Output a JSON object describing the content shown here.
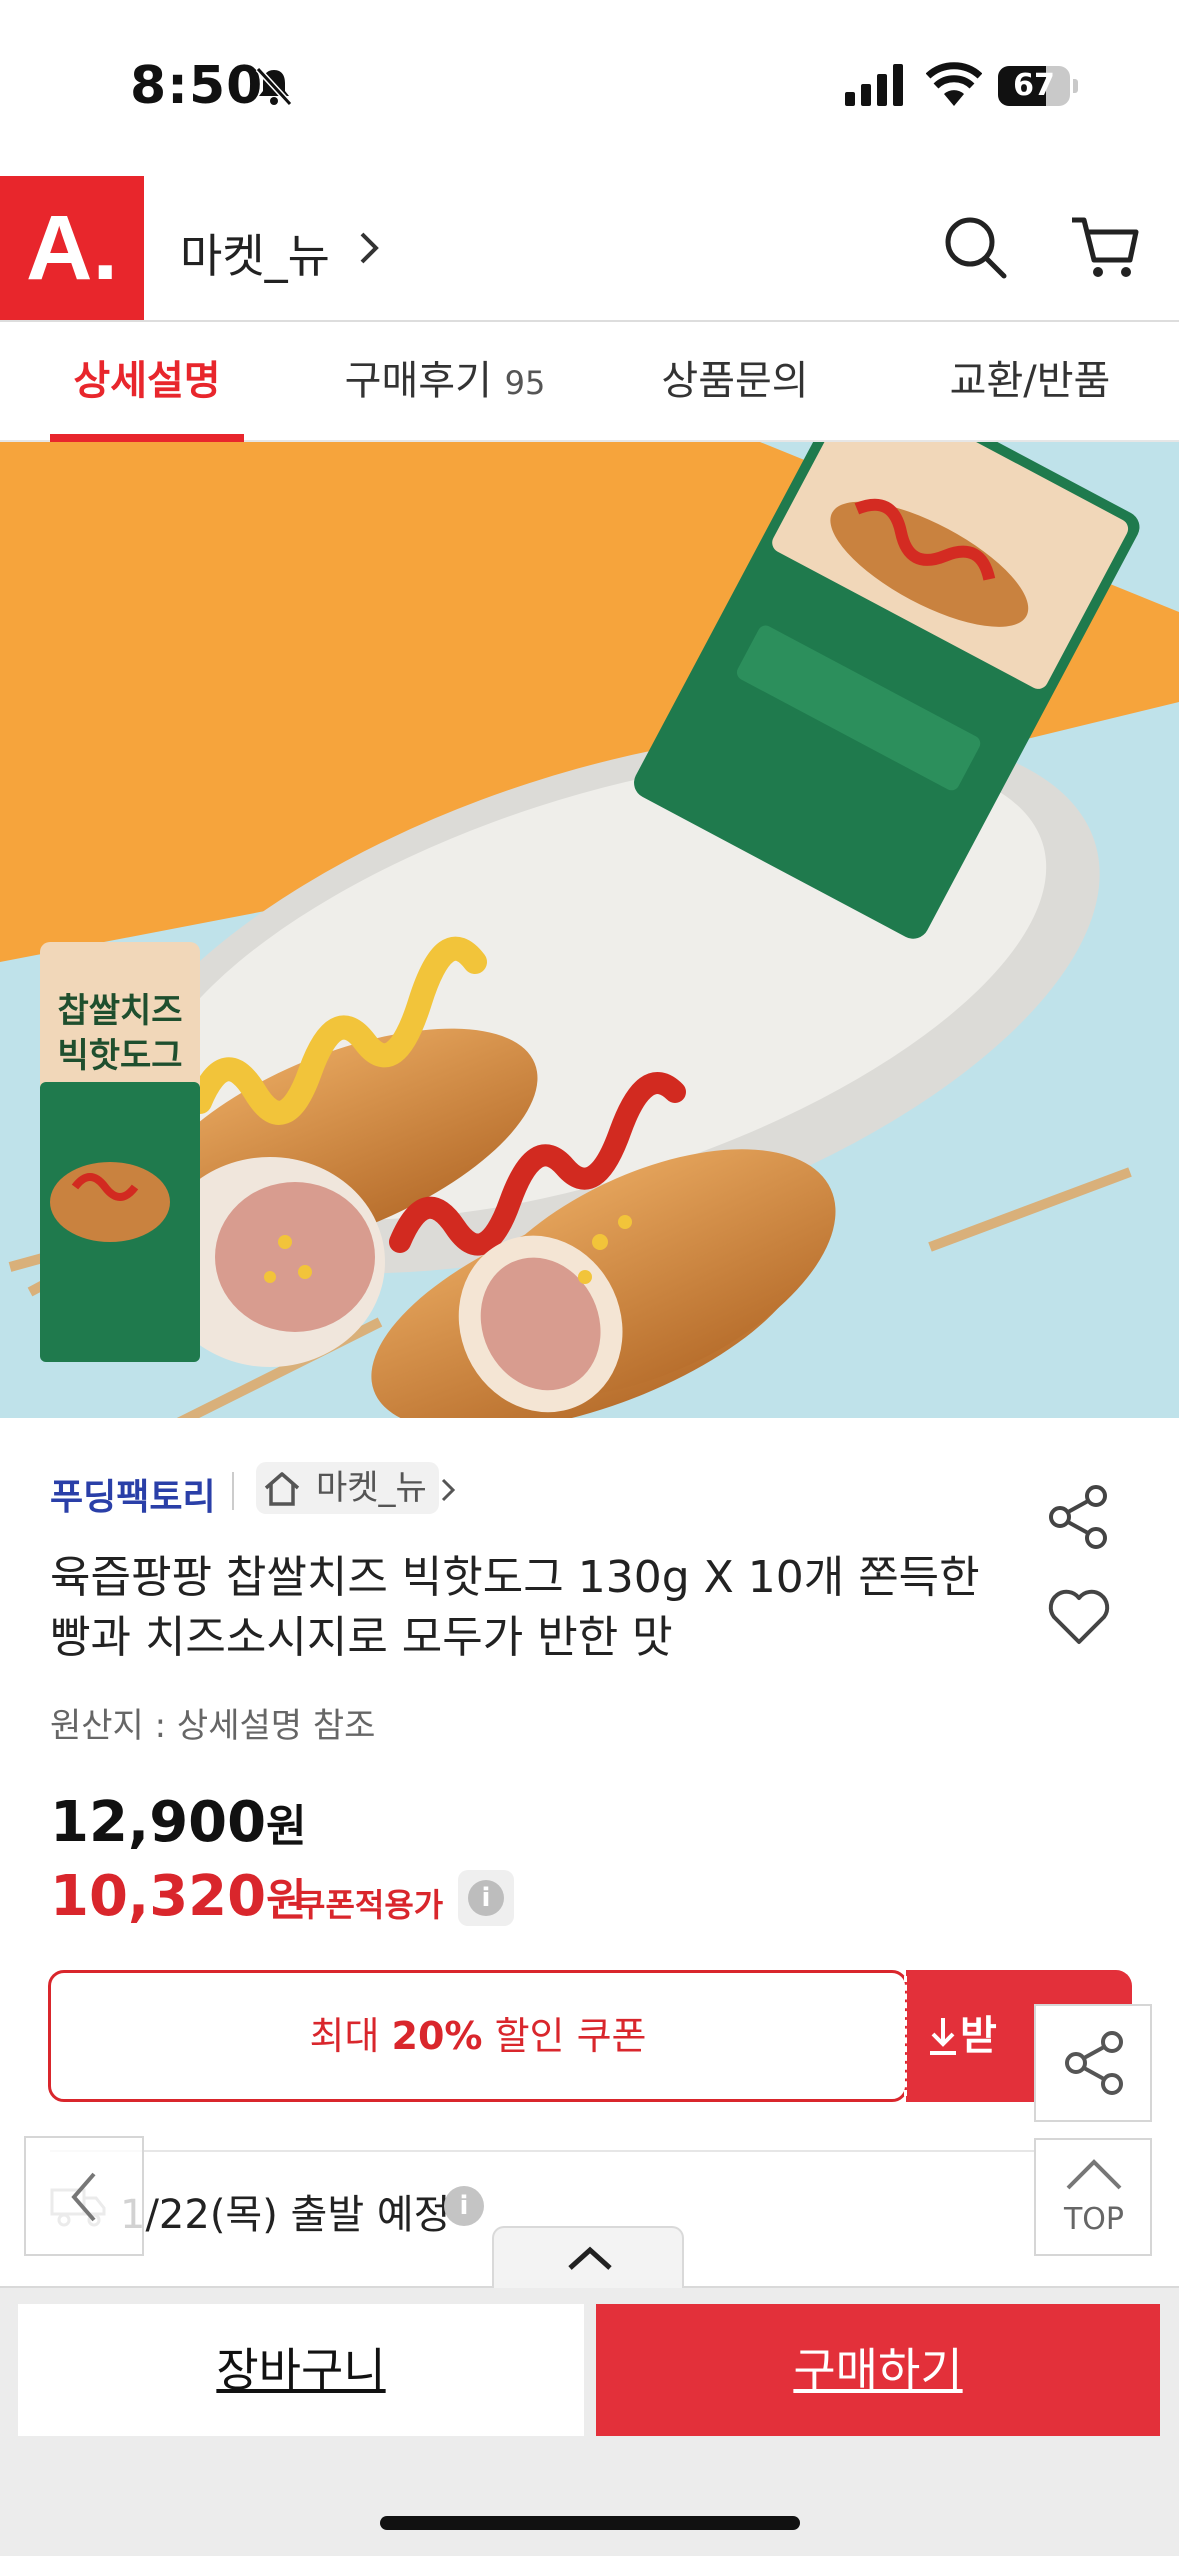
{
  "status_bar": {
    "time": "8:50",
    "battery": "67",
    "battery_level": 0.67
  },
  "header": {
    "logo": "A.",
    "store_name": "마켓_뉴"
  },
  "tabs": [
    {
      "label": "상세설명",
      "active": true
    },
    {
      "label": "구매후기",
      "count": "95"
    },
    {
      "label": "상품문의"
    },
    {
      "label": "교환/반품"
    }
  ],
  "product": {
    "brand": "푸딩팩토리",
    "store_chip": "마켓_뉴",
    "title": "육즙팡팡 찹쌀치즈 빅핫도그 130g X 10개  쫀득한 빵과 치즈소시지로 모두가 반한 맛",
    "origin": "원산지 : 상세설명 참조",
    "price_original": "12,900",
    "price_coupon": "10,320",
    "won": "원",
    "coupon_price_label": "쿠폰적용가"
  },
  "hero": {
    "package_text_1": "찹쌀치즈",
    "package_text_2": "빅핫도그"
  },
  "coupon": {
    "prefix": "최대 ",
    "percent": "20%",
    "suffix": " 할인 쿠폰",
    "download_label": "받"
  },
  "shipping": {
    "text": "1/22(목) 출발 예정"
  },
  "float": {
    "top_label": "TOP"
  },
  "bottom": {
    "cart_label": "장바구니",
    "buy_label": "구매하기"
  },
  "colors": {
    "accent": "#e8262c",
    "brand_link": "#2a3fa8"
  }
}
